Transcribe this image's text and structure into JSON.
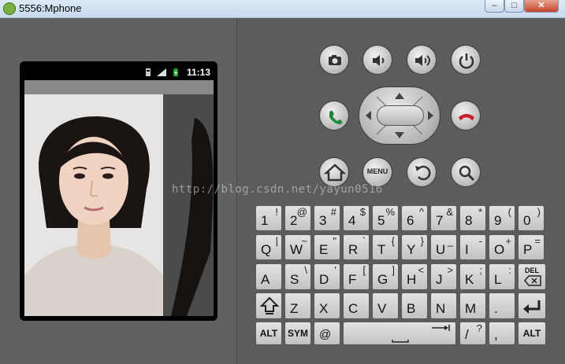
{
  "window": {
    "title": "5556:Mphone",
    "min_glyph": "–",
    "max_glyph": "□",
    "close_glyph": "✕"
  },
  "status_bar": {
    "time": "11:13"
  },
  "watermark": "http://blog.csdn.net/yayun0516",
  "keyboard": {
    "row1": [
      {
        "main": "1",
        "alt": "!"
      },
      {
        "main": "2",
        "alt": "@"
      },
      {
        "main": "3",
        "alt": "#"
      },
      {
        "main": "4",
        "alt": "$"
      },
      {
        "main": "5",
        "alt": "%"
      },
      {
        "main": "6",
        "alt": "^"
      },
      {
        "main": "7",
        "alt": "&"
      },
      {
        "main": "8",
        "alt": "*"
      },
      {
        "main": "9",
        "alt": "("
      },
      {
        "main": "0",
        "alt": ")"
      }
    ],
    "row2": [
      {
        "main": "Q",
        "alt": "|"
      },
      {
        "main": "W",
        "alt": "~"
      },
      {
        "main": "E",
        "alt": "\""
      },
      {
        "main": "R",
        "alt": "`"
      },
      {
        "main": "T",
        "alt": "{"
      },
      {
        "main": "Y",
        "alt": "}"
      },
      {
        "main": "U",
        "alt": "_"
      },
      {
        "main": "I",
        "alt": "-"
      },
      {
        "main": "O",
        "alt": "+"
      },
      {
        "main": "P",
        "alt": "="
      }
    ],
    "row3": [
      {
        "main": "A",
        "alt": ""
      },
      {
        "main": "S",
        "alt": "\\"
      },
      {
        "main": "D",
        "alt": "'"
      },
      {
        "main": "F",
        "alt": "["
      },
      {
        "main": "G",
        "alt": "]"
      },
      {
        "main": "H",
        "alt": "<"
      },
      {
        "main": "J",
        "alt": ">"
      },
      {
        "main": "K",
        "alt": ";"
      },
      {
        "main": "L",
        "alt": ":"
      }
    ],
    "del_label": "DEL",
    "row4": [
      {
        "main": "Z",
        "alt": ""
      },
      {
        "main": "X",
        "alt": ""
      },
      {
        "main": "C",
        "alt": ""
      },
      {
        "main": "V",
        "alt": ""
      },
      {
        "main": "B",
        "alt": ""
      },
      {
        "main": "N",
        "alt": ""
      },
      {
        "main": "M",
        "alt": ""
      },
      {
        "main": ".",
        "alt": ""
      }
    ],
    "alt_label": "ALT",
    "sym_label": "SYM",
    "at_label": "@",
    "slash": {
      "main": "/",
      "alt": "?"
    },
    "comma": {
      "main": ",",
      "alt": ""
    }
  },
  "hardware": {
    "menu_label": "MENU",
    "icons": [
      "camera-icon",
      "volume-down-icon",
      "volume-up-icon",
      "power-icon",
      "call-icon",
      "end-call-icon",
      "home-icon",
      "back-icon",
      "search-icon"
    ]
  }
}
